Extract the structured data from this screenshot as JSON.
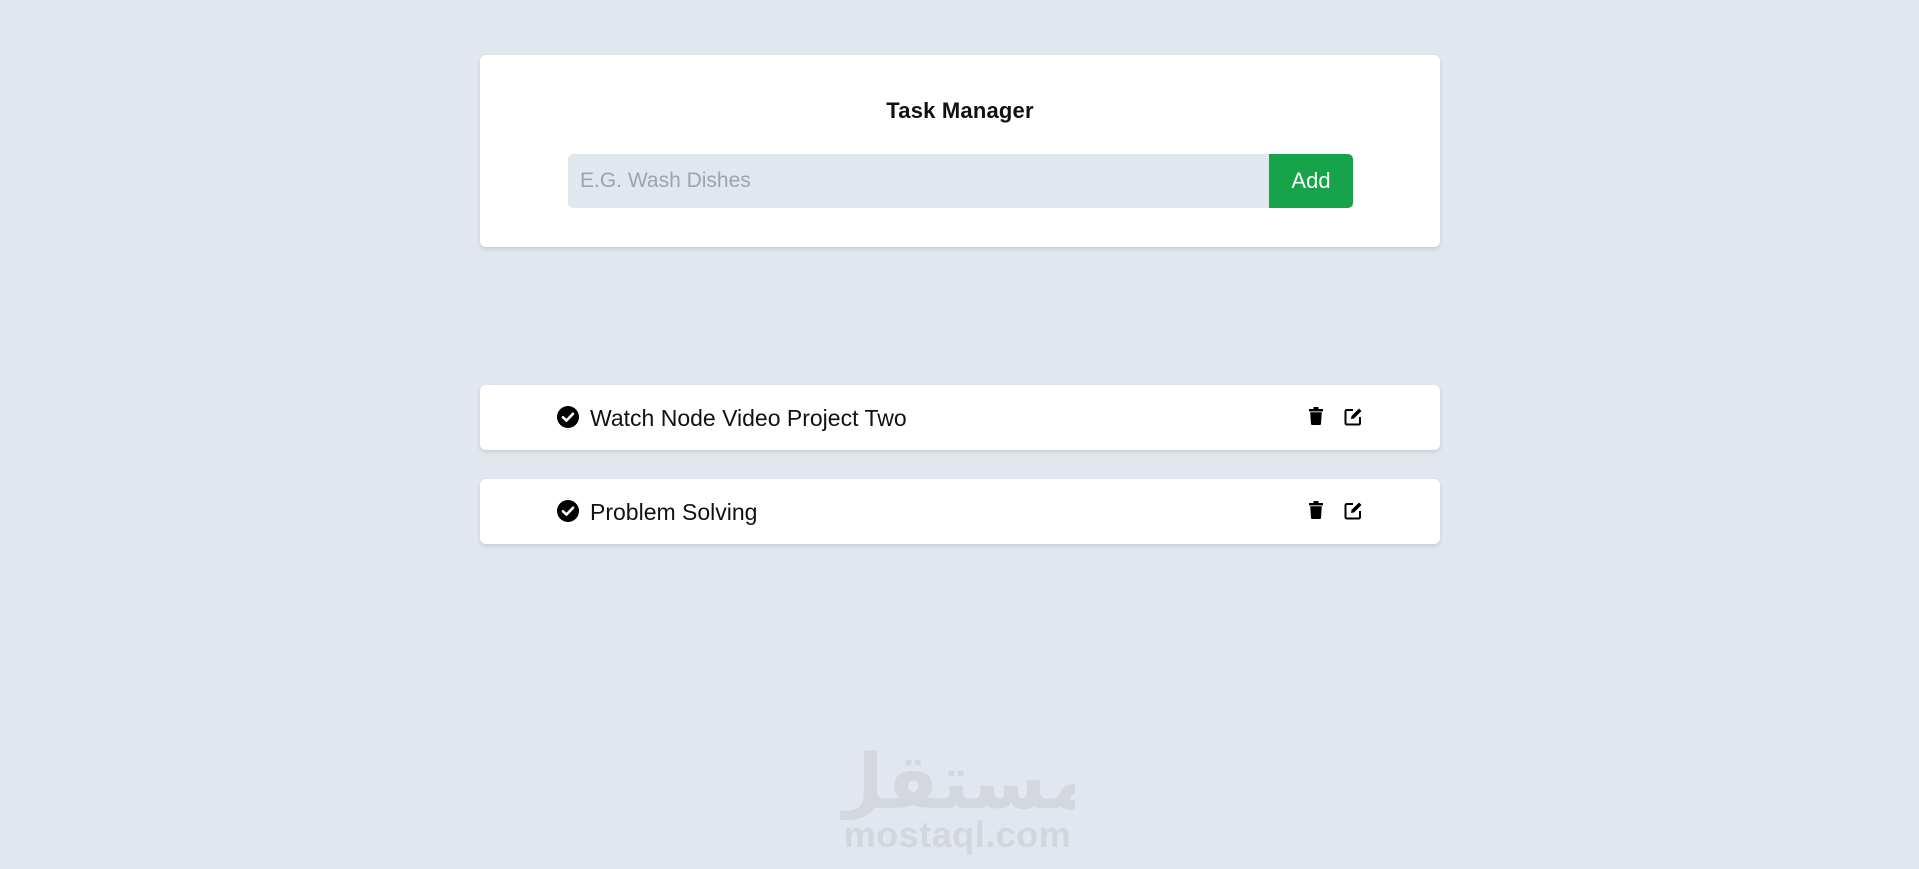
{
  "form": {
    "title": "Task Manager",
    "input_placeholder": "E.G. Wash Dishes",
    "input_value": "",
    "add_label": "Add"
  },
  "tasks": [
    {
      "name": "Watch Node Video Project Two",
      "completed_icon": "check-circle-icon",
      "delete_icon": "trash-icon",
      "edit_icon": "edit-icon"
    },
    {
      "name": "Problem Solving",
      "completed_icon": "check-circle-icon",
      "delete_icon": "trash-icon",
      "edit_icon": "edit-icon"
    }
  ],
  "watermark": {
    "arabic": "مستقل",
    "text": "mostaql.com"
  },
  "colors": {
    "background": "#e1e7ef",
    "card": "#ffffff",
    "accent": "#16a34a"
  }
}
